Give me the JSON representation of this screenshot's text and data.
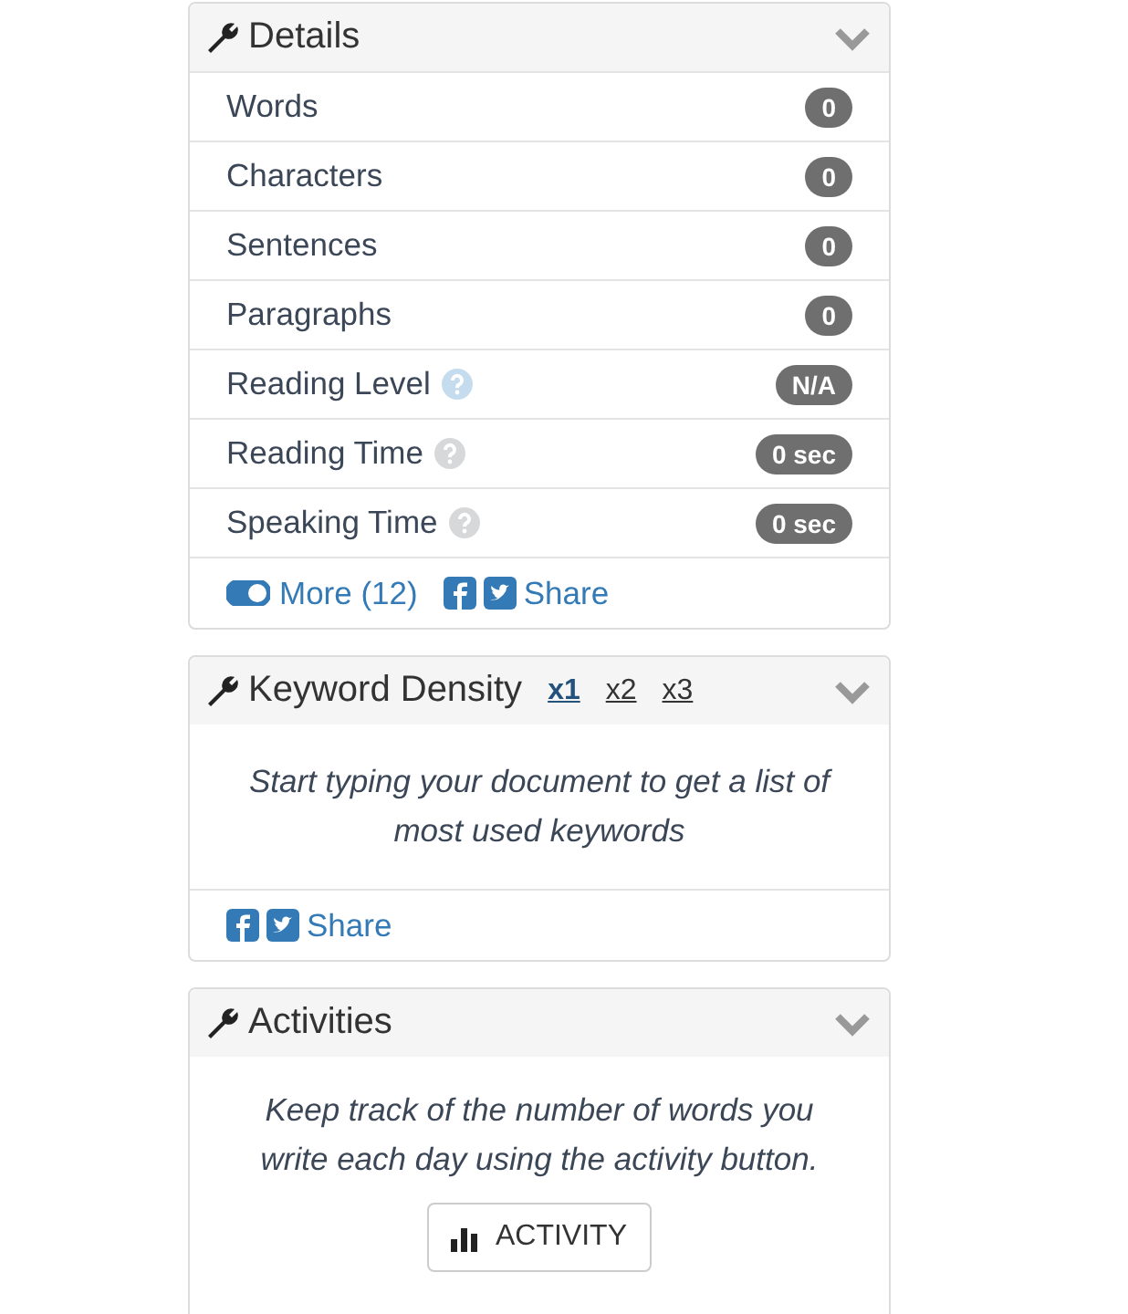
{
  "details": {
    "title": "Details",
    "expanded": true,
    "rows": [
      {
        "label": "Words",
        "value": "0"
      },
      {
        "label": "Characters",
        "value": "0"
      },
      {
        "label": "Sentences",
        "value": "0"
      },
      {
        "label": "Paragraphs",
        "value": "0"
      },
      {
        "label": "Reading Level",
        "value": "N/A",
        "color": "#c5dcef"
      },
      {
        "label": "Reading Time",
        "value": "0 sec",
        "color": "#d6d8da"
      },
      {
        "label": "Speaking Time",
        "value": "0 sec",
        "color": "#d6d8da"
      }
    ],
    "more": {
      "label": "More (12)",
      "on": true
    },
    "share": "Share"
  },
  "keyword_density": {
    "title": "Keyword Density",
    "expanded": true,
    "tabs": [
      {
        "label": "x1",
        "selected": true
      },
      {
        "label": "x2",
        "selected": false
      },
      {
        "label": "x3",
        "selected": false
      }
    ],
    "message": "Start typing your document to get a list of most used keywords",
    "share": "Share"
  },
  "activities": {
    "title": "Activities",
    "expanded": true,
    "message": "Keep track of the number of words you write each day using the activity button.",
    "button": "ACTIVITY"
  }
}
